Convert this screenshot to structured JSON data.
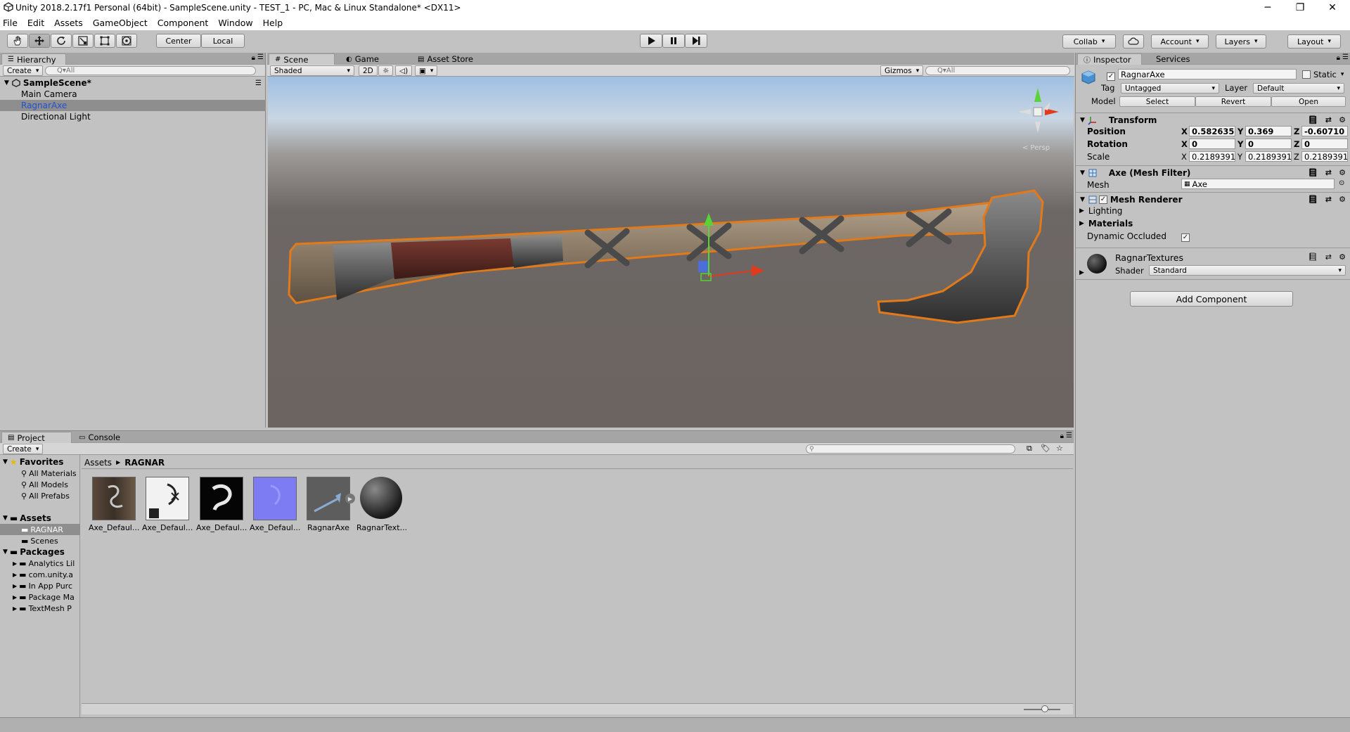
{
  "window": {
    "title": "Unity 2018.2.17f1 Personal (64bit) - SampleScene.unity - TEST_1 - PC, Mac & Linux Standalone* <DX11>",
    "minimize": "─",
    "maximize": "❐",
    "close": "✕"
  },
  "menu": [
    "File",
    "Edit",
    "Assets",
    "GameObject",
    "Component",
    "Window",
    "Help"
  ],
  "toolbar": {
    "pivot_center": "Center",
    "pivot_local": "Local",
    "collab": "Collab",
    "account": "Account",
    "layers": "Layers",
    "layout": "Layout"
  },
  "hierarchy": {
    "tab": "Hierarchy",
    "create": "Create",
    "search_placeholder": "Q▾All",
    "scene": "SampleScene*",
    "items": [
      "Main Camera",
      "RagnarAxe",
      "Directional Light"
    ]
  },
  "scene": {
    "tabs": [
      "Scene",
      "Game",
      "Asset Store"
    ],
    "shading": "Shaded",
    "mode_2d": "2D",
    "gizmos": "Gizmos",
    "search_placeholder": "Q▾All",
    "persp_label": "< Persp"
  },
  "inspector": {
    "tabs": [
      "Inspector",
      "Services"
    ],
    "object_name": "RagnarAxe",
    "static_label": "Static",
    "tag_label": "Tag",
    "tag_value": "Untagged",
    "layer_label": "Layer",
    "layer_value": "Default",
    "model_label": "Model",
    "model_buttons": [
      "Select",
      "Revert",
      "Open"
    ],
    "transform": {
      "title": "Transform",
      "position_label": "Position",
      "rotation_label": "Rotation",
      "scale_label": "Scale",
      "position": {
        "x": "0.582635",
        "y": "0.369",
        "z": "-0.60710"
      },
      "rotation": {
        "x": "0",
        "y": "0",
        "z": "0"
      },
      "scale": {
        "x": "0.2189391",
        "y": "0.2189391",
        "z": "0.2189391"
      }
    },
    "mesh_filter": {
      "title": "Axe (Mesh Filter)",
      "mesh_label": "Mesh",
      "mesh_value": "Axe"
    },
    "mesh_renderer": {
      "title": "Mesh Renderer",
      "lighting": "Lighting",
      "materials": "Materials",
      "dynamic_occluded": "Dynamic Occluded"
    },
    "material": {
      "name": "RagnarTextures",
      "shader_label": "Shader",
      "shader_value": "Standard"
    },
    "add_component": "Add Component"
  },
  "project": {
    "tabs": [
      "Project",
      "Console"
    ],
    "create": "Create",
    "breadcrumb": [
      "Assets",
      "RAGNAR"
    ],
    "tree": {
      "favorites": "Favorites",
      "favorites_items": [
        "All Materials",
        "All Models",
        "All Prefabs"
      ],
      "assets": "Assets",
      "assets_items": [
        "RAGNAR",
        "Scenes"
      ],
      "packages": "Packages",
      "packages_items": [
        "Analytics Lil",
        "com.unity.a",
        "In App Purc",
        "Package Ma",
        "TextMesh P"
      ]
    },
    "assets": [
      "Axe_Defaul...",
      "Axe_Defaul...",
      "Axe_Defaul...",
      "Axe_Defaul...",
      "RagnarAxe",
      "RagnarText..."
    ]
  }
}
